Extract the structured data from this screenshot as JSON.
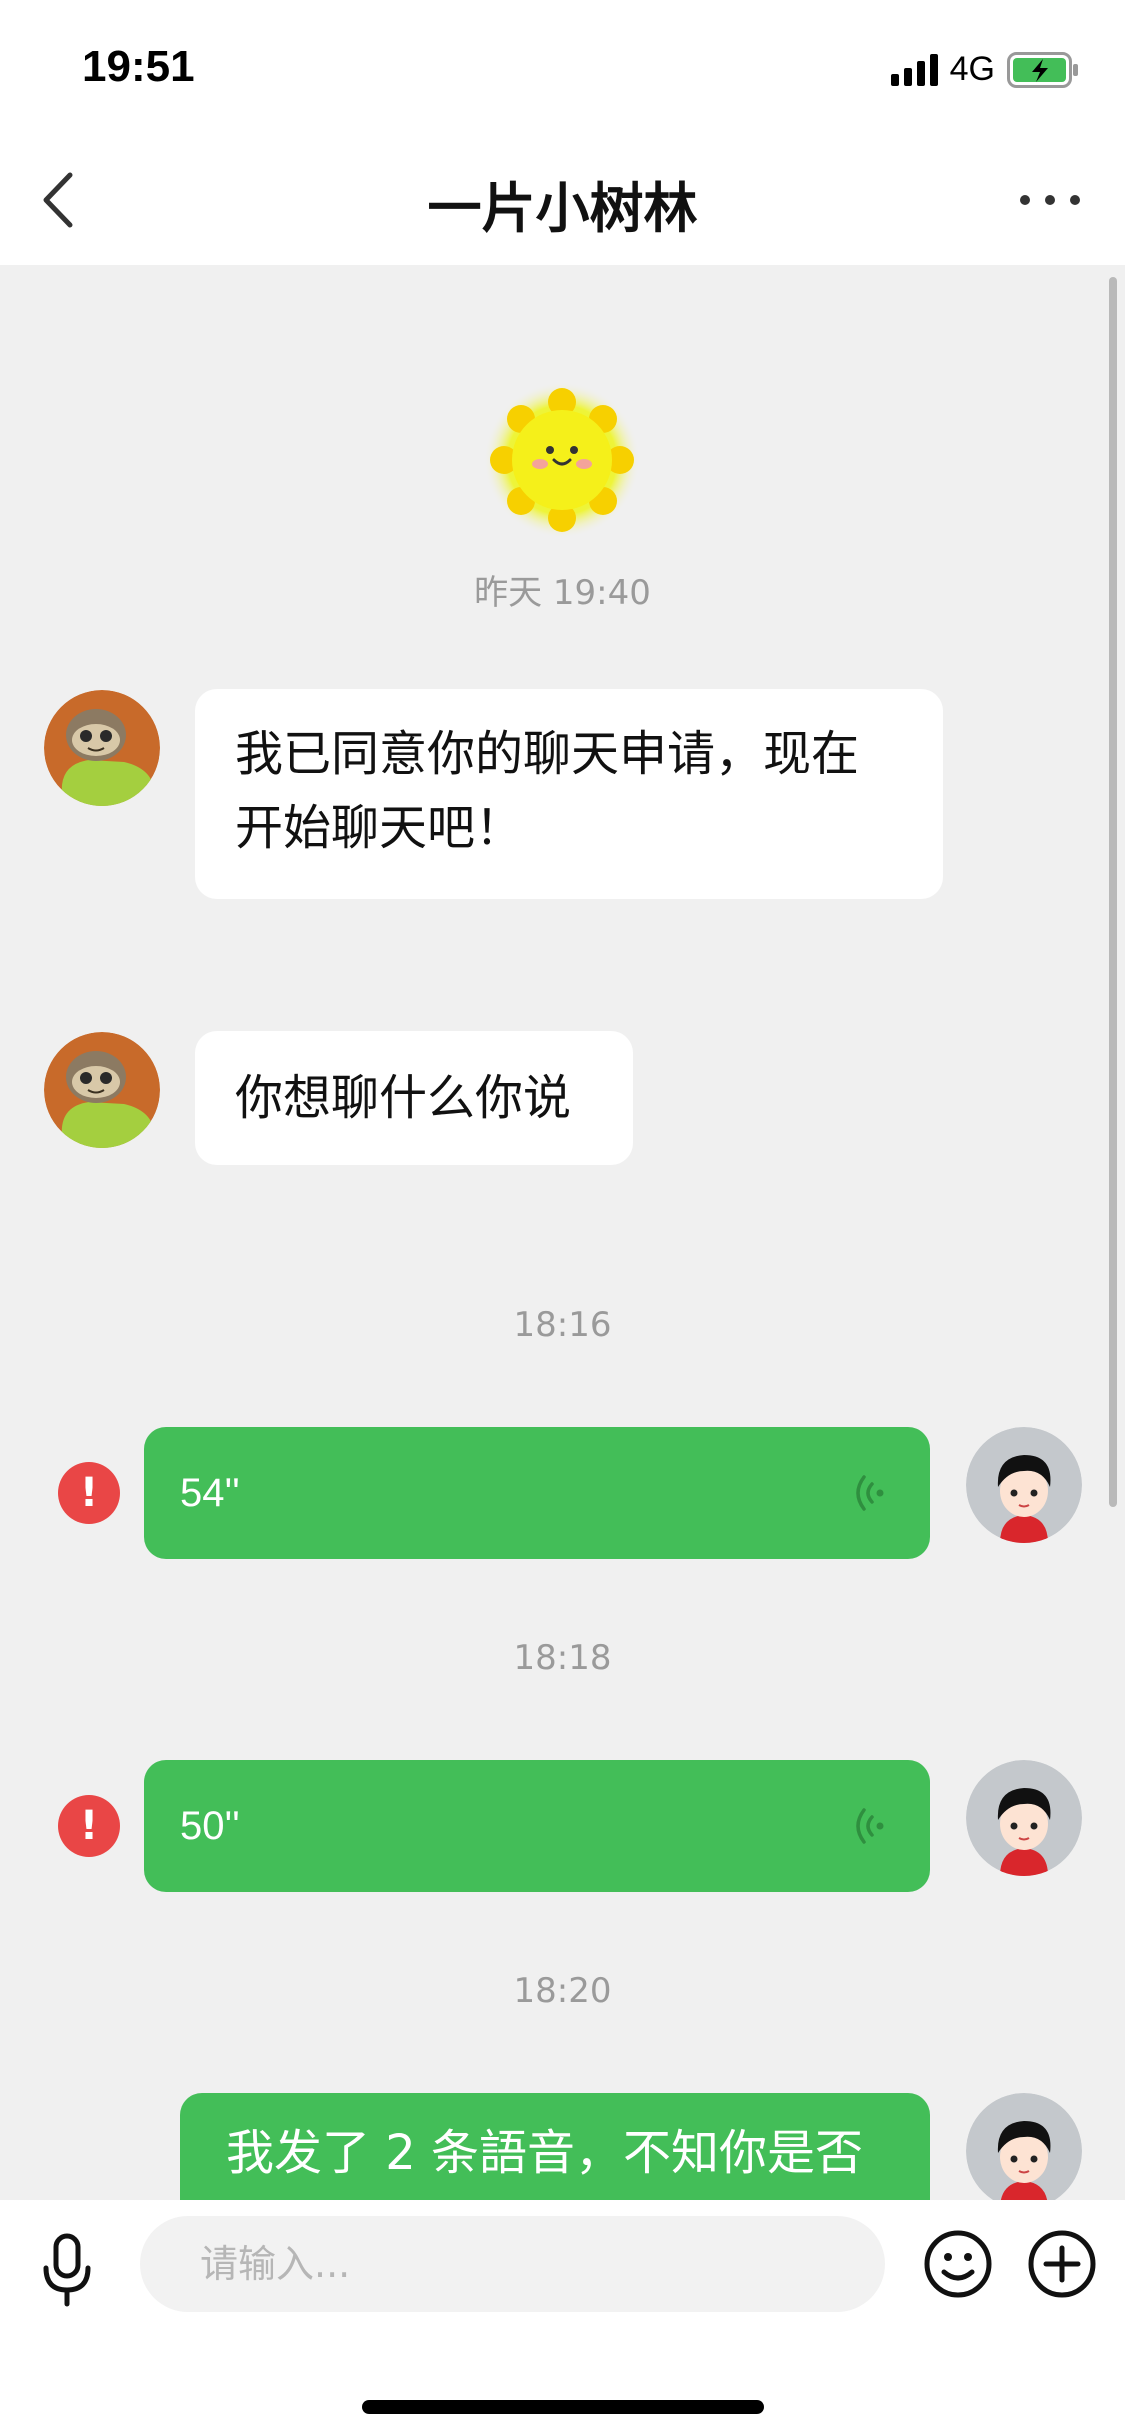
{
  "status_bar": {
    "time": "19:51",
    "network": "4G",
    "battery_state": "charging",
    "battery_color": "#43be58"
  },
  "nav": {
    "title": "一片小树林",
    "back_icon": "chevron-left-icon",
    "more_icon": "more-dots-icon"
  },
  "chat": {
    "background": "#f0f0f0",
    "sticker": "sun-sticker",
    "timestamps": [
      "昨天 19:40",
      "18:16",
      "18:18",
      "18:20"
    ],
    "messages": [
      {
        "direction": "incoming",
        "type": "text",
        "text_line1": "我已同意你的聊天申请，现在",
        "text_line2": "开始聊天吧！"
      },
      {
        "direction": "incoming",
        "type": "text",
        "text": "你想聊什么你说"
      },
      {
        "direction": "outgoing",
        "type": "voice",
        "duration": "54''",
        "status": "failed"
      },
      {
        "direction": "outgoing",
        "type": "voice",
        "duration": "50''",
        "status": "failed"
      },
      {
        "direction": "outgoing",
        "type": "text",
        "text": "我发了 2 条語音，不知你是否"
      }
    ],
    "error_mark": "!",
    "bubble_color_out": "#43be58",
    "bubble_color_in": "#ffffff",
    "error_color": "#e94646"
  },
  "input_bar": {
    "placeholder": "请输入...",
    "mic_icon": "microphone-icon",
    "emoji_icon": "smiley-icon",
    "plus_icon": "plus-circle-icon"
  }
}
